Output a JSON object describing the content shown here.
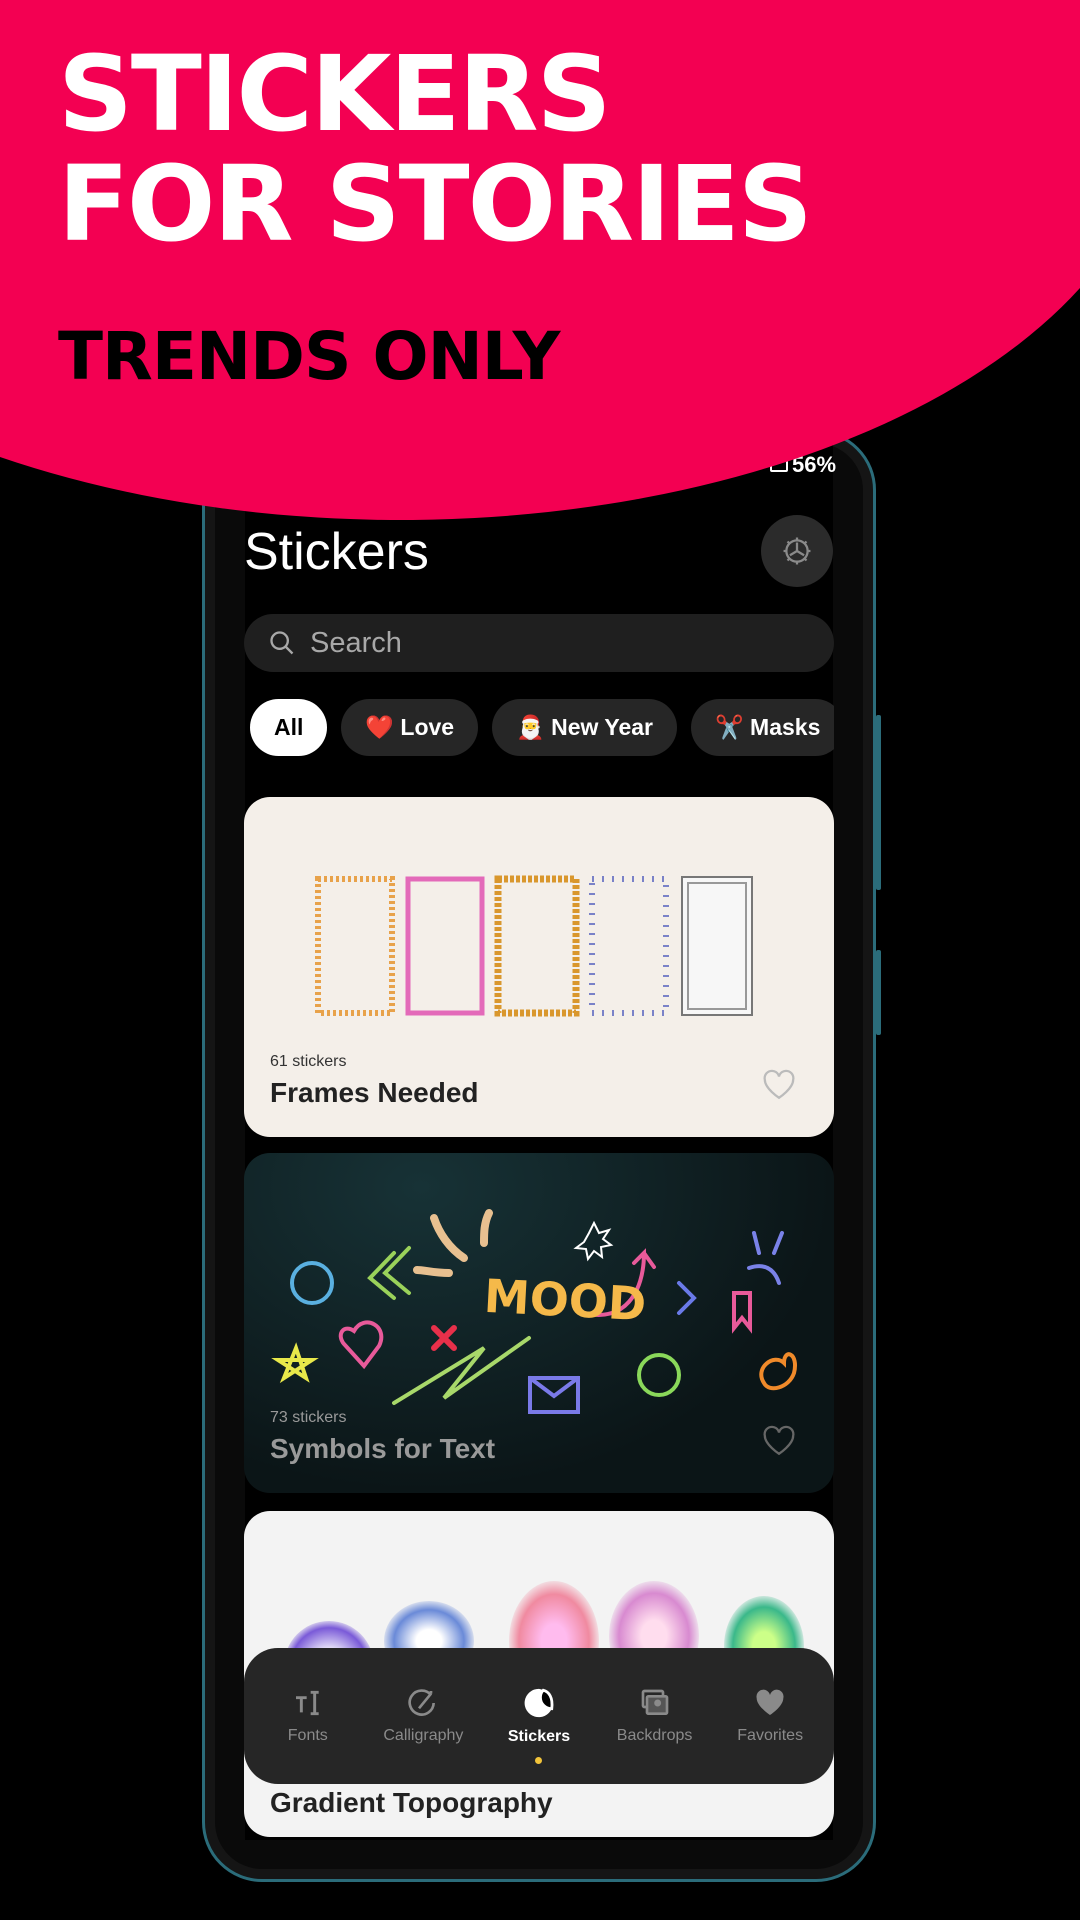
{
  "promo": {
    "headline_line1": "STICKERS",
    "headline_line2": "FOR STORIES",
    "subheadline": "TRENDS ONLY",
    "accent_color": "#f30052"
  },
  "status_bar": {
    "battery": "56%"
  },
  "header": {
    "title": "Stickers",
    "settings_icon": "gear-icon"
  },
  "search": {
    "placeholder": "Search"
  },
  "chips": [
    {
      "label": "All",
      "emoji": "",
      "active": true
    },
    {
      "label": "Love",
      "emoji": "❤️"
    },
    {
      "label": "New Year",
      "emoji": "🎅"
    },
    {
      "label": "Masks",
      "emoji": "✂️"
    }
  ],
  "packs": [
    {
      "count": "61 stickers",
      "name": "Frames Needed",
      "favorited": false
    },
    {
      "count": "73 stickers",
      "name": "Symbols for Text",
      "favorited": false,
      "art_text": "MOOD"
    },
    {
      "count": "",
      "name": "Gradient Topography",
      "favorited": false
    }
  ],
  "nav": {
    "items": [
      {
        "label": "Fonts",
        "icon": "text-icon"
      },
      {
        "label": "Calligraphy",
        "icon": "pen-icon"
      },
      {
        "label": "Stickers",
        "icon": "sticker-icon",
        "active": true
      },
      {
        "label": "Backdrops",
        "icon": "images-icon"
      },
      {
        "label": "Favorites",
        "icon": "heart-icon"
      }
    ],
    "indicator_color": "#f2c43a"
  }
}
